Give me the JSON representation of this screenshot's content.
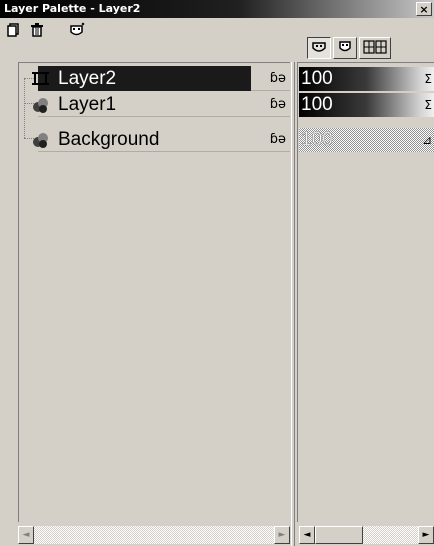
{
  "window": {
    "title": "Layer Palette - Layer2",
    "close_label": "×"
  },
  "toolbar": {
    "new_layer_icon": "new-layer-icon",
    "delete_layer_icon": "trash-icon",
    "mask_icon": "mask-icon"
  },
  "tabs": [
    {
      "icon": "layer-visibility-tab-icon",
      "pressed": true
    },
    {
      "icon": "mask-tab-icon",
      "pressed": false
    },
    {
      "icon": "layer-groups-tab-icon",
      "pressed": false
    }
  ],
  "layers": [
    {
      "name": "Layer2",
      "type": "vector",
      "selected": true,
      "visibility_icon": "ɓə",
      "opacity": "100",
      "opacity_arrow": "Σ"
    },
    {
      "name": "Layer1",
      "type": "raster",
      "selected": false,
      "visibility_icon": "ɓə",
      "opacity": "100",
      "opacity_arrow": "Σ"
    },
    {
      "name": "Background",
      "type": "raster",
      "selected": false,
      "visibility_icon": "ɓə",
      "opacity": "100",
      "opacity_arrow": "⊿"
    }
  ],
  "scrollbars": {
    "left": {
      "left_arrow": "◄",
      "right_arrow": "►"
    },
    "right": {
      "left_arrow": "◄",
      "right_arrow": "►"
    }
  },
  "colors": {
    "title_bg": "#000000",
    "selected_row": "#000000",
    "face": "#d4d0c8"
  }
}
